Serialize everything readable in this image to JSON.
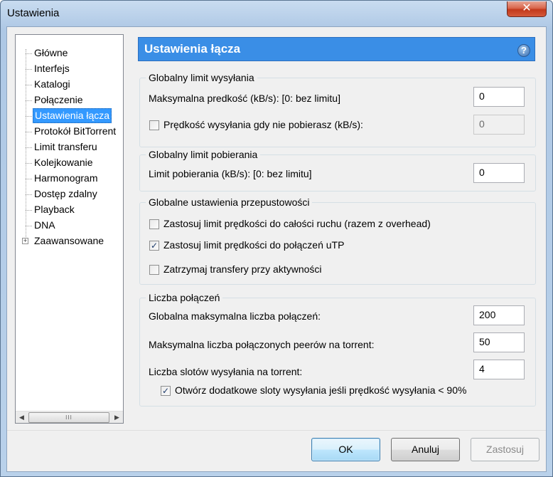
{
  "window": {
    "title": "Ustawienia",
    "close_glyph": "✕"
  },
  "tree": {
    "items": [
      {
        "label": "Główne"
      },
      {
        "label": "Interfejs"
      },
      {
        "label": "Katalogi"
      },
      {
        "label": "Połączenie"
      },
      {
        "label": "Ustawienia łącza",
        "selected": true
      },
      {
        "label": "Protokół BitTorrent"
      },
      {
        "label": "Limit transferu"
      },
      {
        "label": "Kolejkowanie"
      },
      {
        "label": "Harmonogram"
      },
      {
        "label": "Dostęp zdalny"
      },
      {
        "label": "Playback"
      },
      {
        "label": "DNA"
      },
      {
        "label": "Zaawansowane",
        "expandable": true
      }
    ],
    "expander_glyph": "+",
    "scroll_left": "◀",
    "scroll_right": "▶",
    "scroll_thumb": "III"
  },
  "header": {
    "title": "Ustawienia łącza",
    "help_glyph": "?"
  },
  "upload_group": {
    "title": "Globalny limit wysyłania",
    "max_speed_label": "Maksymalna predkość (kB/s): [0: bez limitu]",
    "max_speed_value": "0",
    "alt_speed_label": "Prędkość wysyłania gdy nie pobierasz (kB/s):",
    "alt_speed_checked": false,
    "alt_speed_value": "0"
  },
  "download_group": {
    "title": "Globalny limit pobierania",
    "limit_label": "Limit pobierania (kB/s): [0: bez limitu]",
    "limit_value": "0"
  },
  "bandwidth_group": {
    "title": "Globalne ustawienia przepustowości",
    "opt1_label": "Zastosuj limit prędkości do całości ruchu (razem z overhead)",
    "opt1_checked": false,
    "opt2_label": "Zastosuj limit prędkości do połączeń uTP",
    "opt2_checked": true,
    "opt3_label": "Zatrzymaj transfery przy aktywności",
    "opt3_checked": false
  },
  "connections_group": {
    "title": "Liczba połączeń",
    "global_max_label": "Globalna maksymalna liczba połączeń:",
    "global_max_value": "200",
    "peers_label": "Maksymalna liczba połączonych peerów na torrent:",
    "peers_value": "50",
    "slots_label": "Liczba slotów wysyłania na torrent:",
    "slots_value": "4",
    "extra_slots_label": "Otwórz dodatkowe sloty wysyłania jeśli prędkość wysyłania < 90%",
    "extra_slots_checked": true
  },
  "buttons": {
    "ok": "OK",
    "cancel": "Anuluj",
    "apply": "Zastosuj"
  },
  "check_glyph": "✓"
}
